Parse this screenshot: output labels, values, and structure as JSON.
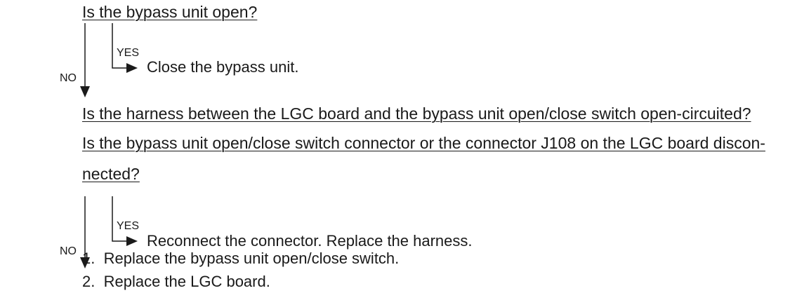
{
  "q1": {
    "question": "Is the bypass unit open?",
    "yes": "YES",
    "no": "NO",
    "action": "Close the bypass unit."
  },
  "q2": {
    "question_line1": "Is the harness between the LGC board and the bypass unit open/close switch open-circuited?",
    "question_line2": "Is the bypass unit open/close switch connector or the connector J108 on the LGC board discon-",
    "question_line3": "nected?",
    "yes": "YES",
    "no": "NO",
    "action": "Reconnect the connector. Replace the harness."
  },
  "final_steps": [
    {
      "num": "1.",
      "text": "Replace the bypass unit open/close switch."
    },
    {
      "num": "2.",
      "text": "Replace the LGC board."
    }
  ]
}
